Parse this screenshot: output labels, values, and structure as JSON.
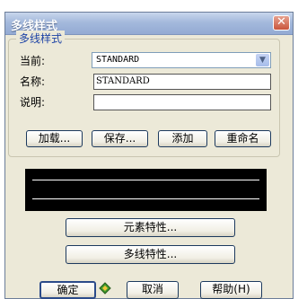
{
  "window": {
    "title": "多线样式",
    "close_glyph": "✕"
  },
  "group": {
    "title": "多线样式"
  },
  "fields": {
    "current_label": "当前:",
    "current_value": "STANDARD",
    "name_label": "名称:",
    "name_value": "STANDARD",
    "desc_label": "说明:",
    "desc_value": ""
  },
  "buttons": {
    "load": "加载...",
    "save": "保存...",
    "add": "添加",
    "rename": "重命名",
    "element_props": "元素特性...",
    "mline_props": "多线特性...",
    "ok": "确定",
    "cancel": "取消",
    "help": "帮助(H)"
  },
  "icons": {
    "close": "close-icon",
    "dropdown": "chevron-down-icon",
    "ok_cursor": "shield-icon"
  }
}
